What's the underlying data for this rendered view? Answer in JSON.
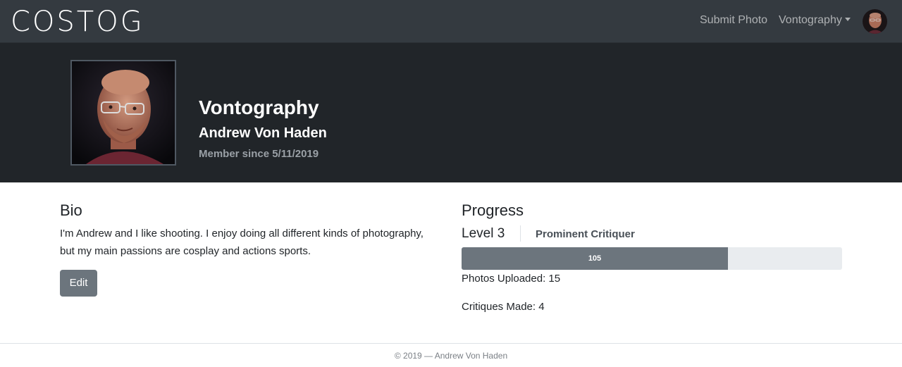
{
  "navbar": {
    "brand": "COSTOG",
    "submit_photo": "Submit Photo",
    "user_menu": "Vontography"
  },
  "profile": {
    "username": "Vontography",
    "full_name": "Andrew Von Haden",
    "member_since": "Member since 5/11/2019"
  },
  "bio": {
    "title": "Bio",
    "text": "I'm Andrew and I like shooting. I enjoy doing all different kinds of photography, but my main passions are cosplay and actions sports.",
    "edit_label": "Edit"
  },
  "progress": {
    "title": "Progress",
    "level": "Level 3",
    "rank": "Prominent Critiquer",
    "points_label": "105",
    "fill_fraction": 0.7,
    "photos_uploaded": "Photos Uploaded: 15",
    "critiques_made": "Critiques Made: 4"
  },
  "footer": {
    "text": "© 2019 — Andrew Von Haden"
  },
  "colors": {
    "navbar_bg": "#343a40",
    "hero_bg": "#212529",
    "progress_fill": "#6c757d",
    "progress_track": "#e9ecef",
    "button_bg": "#6c757d"
  }
}
